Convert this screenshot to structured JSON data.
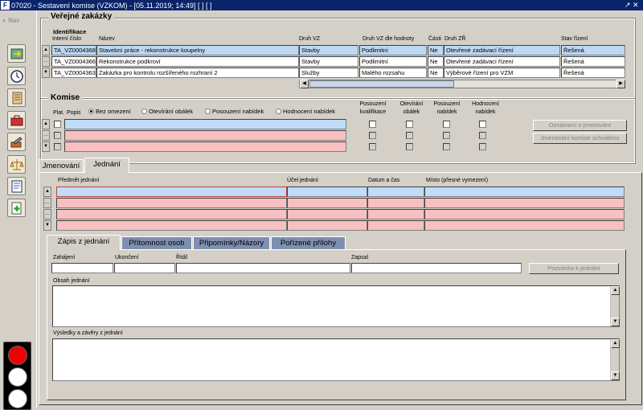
{
  "window": {
    "title": "07020 - Sestavení komise (VZKOM) - [05.11.2019; 14:49]  [ ]  [ ]",
    "controls": "↗ ✕"
  },
  "nav": {
    "label": "Nav"
  },
  "verejne": {
    "title": "Veřejné zakázky",
    "section": "Identifikace",
    "headers": [
      "Interní číslo",
      "Název",
      "Druh VZ",
      "Druh VZ dle hodnoty",
      "Části",
      "Druh ZŘ",
      "Stav řízení"
    ],
    "rows": [
      [
        "TA_VZ0004368",
        "Stavební práce - rekonstrukce koupelny",
        "Stavby",
        "Podlimitní",
        "Ne",
        "Otevřené zadávací řízení",
        "Řešená"
      ],
      [
        "TA_VZ0004366",
        "Rekonstrukce podkroví",
        "Stavby",
        "Podlimitní",
        "Ne",
        "Otevřené zadávací řízení",
        "Řešená"
      ],
      [
        "TA_VZ0004363",
        "Zakázka pro kontrolu rozšířeného rozhraní 2",
        "Služby",
        "Malého rozsahu",
        "Ne",
        "Výběrové řízení pro VZM",
        "Řešená"
      ]
    ]
  },
  "komise": {
    "title": "Komise",
    "plat": "Plat.",
    "popis": "Popis",
    "radios": [
      "Bez omezení",
      "Otevírání obálek",
      "Posouzení nabídek",
      "Hodnocení nabídek"
    ],
    "cols": [
      "Posouzení kvalifikace",
      "Otevírání obálek",
      "Posouzení nabídek",
      "Hodnocení nabídek"
    ],
    "btn1": "Oznámení o jmenování",
    "btn2": "Jmenování komise schváleno"
  },
  "tabs": [
    "Jmenování",
    "Jednání"
  ],
  "jednani": {
    "headers": [
      "Předmět jednání",
      "Účel jednání",
      "Datum a čas",
      "Místo (přesné vymezení)"
    ]
  },
  "subtabs": [
    "Zápis z jednání",
    "Přítomnost osob",
    "Připomínky/Názory",
    "Pořízené přílohy"
  ],
  "zapis": {
    "zahajeni": "Zahájení",
    "ukonceni": "Ukončení",
    "ridil": "Řídil",
    "zapsal": "Zapsal",
    "pozvanka": "Pozvánka k jednání",
    "obsah": "Obsah jednání",
    "vysledky": "Výsledky a závěry z jednání"
  }
}
